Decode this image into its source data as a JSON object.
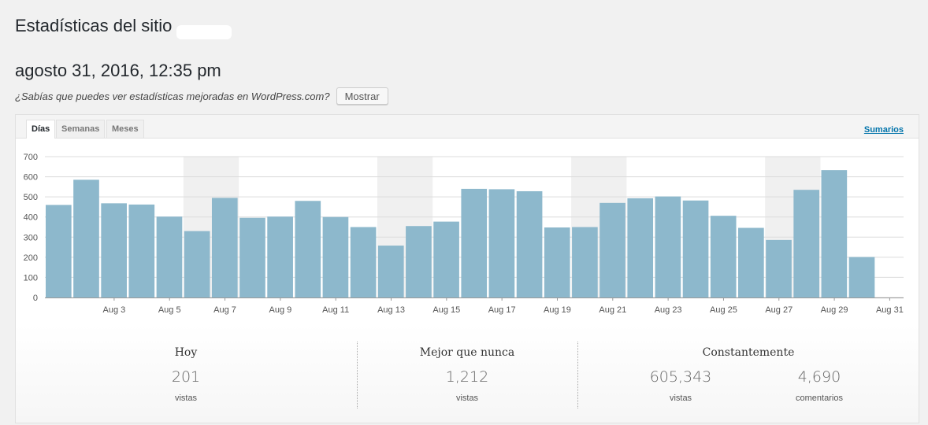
{
  "page": {
    "title": "Estadísticas del sitio",
    "date_heading": "agosto 31, 2016, 12:35 pm",
    "promo_text": "¿Sabías que puedes ver estadísticas mejoradas en WordPress.com?",
    "show_button": "Mostrar"
  },
  "tabs": [
    {
      "label": "Días",
      "active": true
    },
    {
      "label": "Semanas",
      "active": false
    },
    {
      "label": "Meses",
      "active": false
    }
  ],
  "summaries_link": "Sumarios",
  "chart_data": {
    "type": "bar",
    "categories": [
      "Aug 1",
      "Aug 2",
      "Aug 3",
      "Aug 4",
      "Aug 5",
      "Aug 6",
      "Aug 7",
      "Aug 8",
      "Aug 9",
      "Aug 10",
      "Aug 11",
      "Aug 12",
      "Aug 13",
      "Aug 14",
      "Aug 15",
      "Aug 16",
      "Aug 17",
      "Aug 18",
      "Aug 19",
      "Aug 20",
      "Aug 21",
      "Aug 22",
      "Aug 23",
      "Aug 24",
      "Aug 25",
      "Aug 26",
      "Aug 27",
      "Aug 28",
      "Aug 29",
      "Aug 30",
      "Aug 31"
    ],
    "x_tick_labels": [
      "Aug 3",
      "Aug 5",
      "Aug 7",
      "Aug 9",
      "Aug 11",
      "Aug 13",
      "Aug 15",
      "Aug 17",
      "Aug 19",
      "Aug 21",
      "Aug 23",
      "Aug 25",
      "Aug 27",
      "Aug 29",
      "Aug 31"
    ],
    "values": [
      460,
      585,
      468,
      462,
      402,
      330,
      495,
      396,
      402,
      480,
      400,
      350,
      258,
      355,
      377,
      540,
      538,
      528,
      348,
      350,
      470,
      493,
      502,
      482,
      406,
      346,
      286,
      535,
      633,
      201
    ],
    "ylim": [
      0,
      700
    ],
    "yticks": [
      0,
      100,
      200,
      300,
      400,
      500,
      600,
      700
    ],
    "weekend_shading_categories": [
      [
        "Aug 6",
        "Aug 7"
      ],
      [
        "Aug 13",
        "Aug 14"
      ],
      [
        "Aug 20",
        "Aug 21"
      ],
      [
        "Aug 27",
        "Aug 28"
      ]
    ],
    "bar_color": "#8db8cc",
    "shade_color": "#f0f0f0",
    "grid": true
  },
  "stats": {
    "today": {
      "title": "Hoy",
      "value": "201",
      "unit": "vistas"
    },
    "best": {
      "title": "Mejor que nunca",
      "value": "1,212",
      "unit": "vistas"
    },
    "ongoing": {
      "title": "Constantemente",
      "views_value": "605,343",
      "views_unit": "vistas",
      "comments_value": "4,690",
      "comments_unit": "comentarios"
    }
  }
}
